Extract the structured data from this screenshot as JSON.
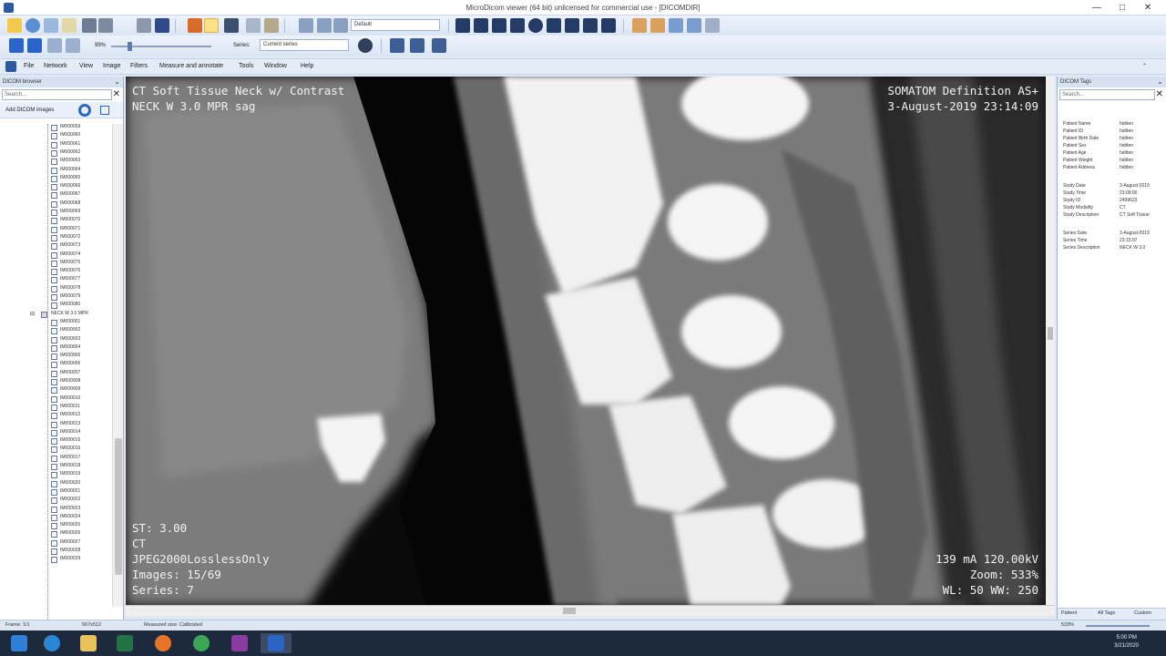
{
  "window": {
    "title": "MicroDicom viewer (64 bit) unlicensed for commercial use - [DICOMDIR]",
    "controls": [
      "—",
      "□",
      "✕"
    ]
  },
  "toolbar": {
    "preset": "Default",
    "zoom": "99%",
    "series_label": "Series:",
    "series_value": "Current series"
  },
  "menu": [
    "File",
    "Network",
    "View",
    "Image",
    "Filters",
    "Measure and annotate",
    "Tools",
    "Window",
    "Help"
  ],
  "left_panel": {
    "title": "DICOM browser",
    "search_placeholder": "Search...",
    "add_label": "Add DICOM images",
    "series_node": "NECK W 3.0 MPR",
    "items_top": [
      "IM000059",
      "IM000060",
      "IM000061",
      "IM000062",
      "IM000063",
      "IM000064",
      "IM000065",
      "IM000066",
      "IM000067",
      "IM000068",
      "IM000069",
      "IM000070",
      "IM000071",
      "IM000072",
      "IM000073",
      "IM000074",
      "IM000075",
      "IM000076",
      "IM000077",
      "IM000078",
      "IM000079",
      "IM000080"
    ],
    "items_bottom": [
      "IM000001",
      "IM000002",
      "IM000003",
      "IM000004",
      "IM000005",
      "IM000006",
      "IM000007",
      "IM000008",
      "IM000009",
      "IM000010",
      "IM000011",
      "IM000012",
      "IM000013",
      "IM000014",
      "IM000015",
      "IM000016",
      "IM000017",
      "IM000018",
      "IM000019",
      "IM000020",
      "IM000021",
      "IM000022",
      "IM000023",
      "IM000024",
      "IM000025",
      "IM000026",
      "IM000027",
      "IM000028",
      "IM000029"
    ]
  },
  "overlay": {
    "top_left_1": "CT Soft Tissue Neck w/ Contrast",
    "top_left_2": "NECK W  3.0  MPR  sag",
    "top_right_1": "SOMATOM Definition AS+",
    "top_right_2": "3-August-2019 23:14:09",
    "bottom_left": [
      "ST: 3.00",
      "CT",
      "JPEG2000LosslessOnly",
      "Images: 15/69",
      "Series: 7"
    ],
    "bottom_right": [
      "139 mA 120.00kV",
      "Zoom: 533%",
      "WL: 50 WW: 250"
    ]
  },
  "right_panel": {
    "title": "DICOM Tags",
    "search_placeholder": "Search...",
    "tags": [
      {
        "k": "Patient Name",
        "v": "hidden"
      },
      {
        "k": "Patient ID",
        "v": "hidden"
      },
      {
        "k": "Patient Birth Date",
        "v": "hidden"
      },
      {
        "k": "Patient Sex",
        "v": "hidden"
      },
      {
        "k": "Patient Age",
        "v": "hidden"
      },
      {
        "k": "Patient Weight",
        "v": "hidden"
      },
      {
        "k": "Patient Address",
        "v": "hidden"
      },
      {
        "k": "Study Date",
        "v": "3-August-2019"
      },
      {
        "k": "Study Time",
        "v": "23:09:00"
      },
      {
        "k": "Study ID",
        "v": "2499623"
      },
      {
        "k": "Study Modality",
        "v": "CT"
      },
      {
        "k": "Study Description",
        "v": "CT Soft Tissue"
      },
      {
        "k": "Series Date",
        "v": "3-August-2019"
      },
      {
        "k": "Series Time",
        "v": "23:15:07"
      },
      {
        "k": "Series Description",
        "v": "NECK W 3.0"
      }
    ],
    "tabs": [
      "Patient",
      "All Tags",
      "Custom"
    ]
  },
  "status": {
    "frame": "Frame: 1/1",
    "size": "567x512",
    "measured": "Measured size: Calibrated",
    "zoom": "533%"
  },
  "clock": {
    "time": "5:00 PM",
    "date": "3/21/2020"
  }
}
